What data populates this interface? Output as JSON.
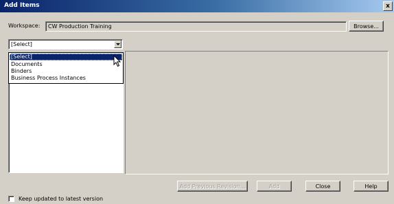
{
  "window": {
    "title": "Add Items",
    "close_glyph": "x"
  },
  "workspace": {
    "label": "Workspace:",
    "value": "CW Production Training",
    "browse_label": "Browse..."
  },
  "type_select": {
    "selected": "[Select]",
    "options": [
      "[Select]",
      "Documents",
      "Binders",
      "Business Process Instances"
    ]
  },
  "buttons": {
    "add_previous_revision": "Add Previous Revision...",
    "add": "Add",
    "close": "Close",
    "help": "Help"
  },
  "keep_updated": {
    "label": "Keep updated to latest version",
    "checked": false
  },
  "colors": {
    "title_bar": "#0a246a",
    "selection": "#0a246a",
    "face": "#d4d0c8"
  }
}
